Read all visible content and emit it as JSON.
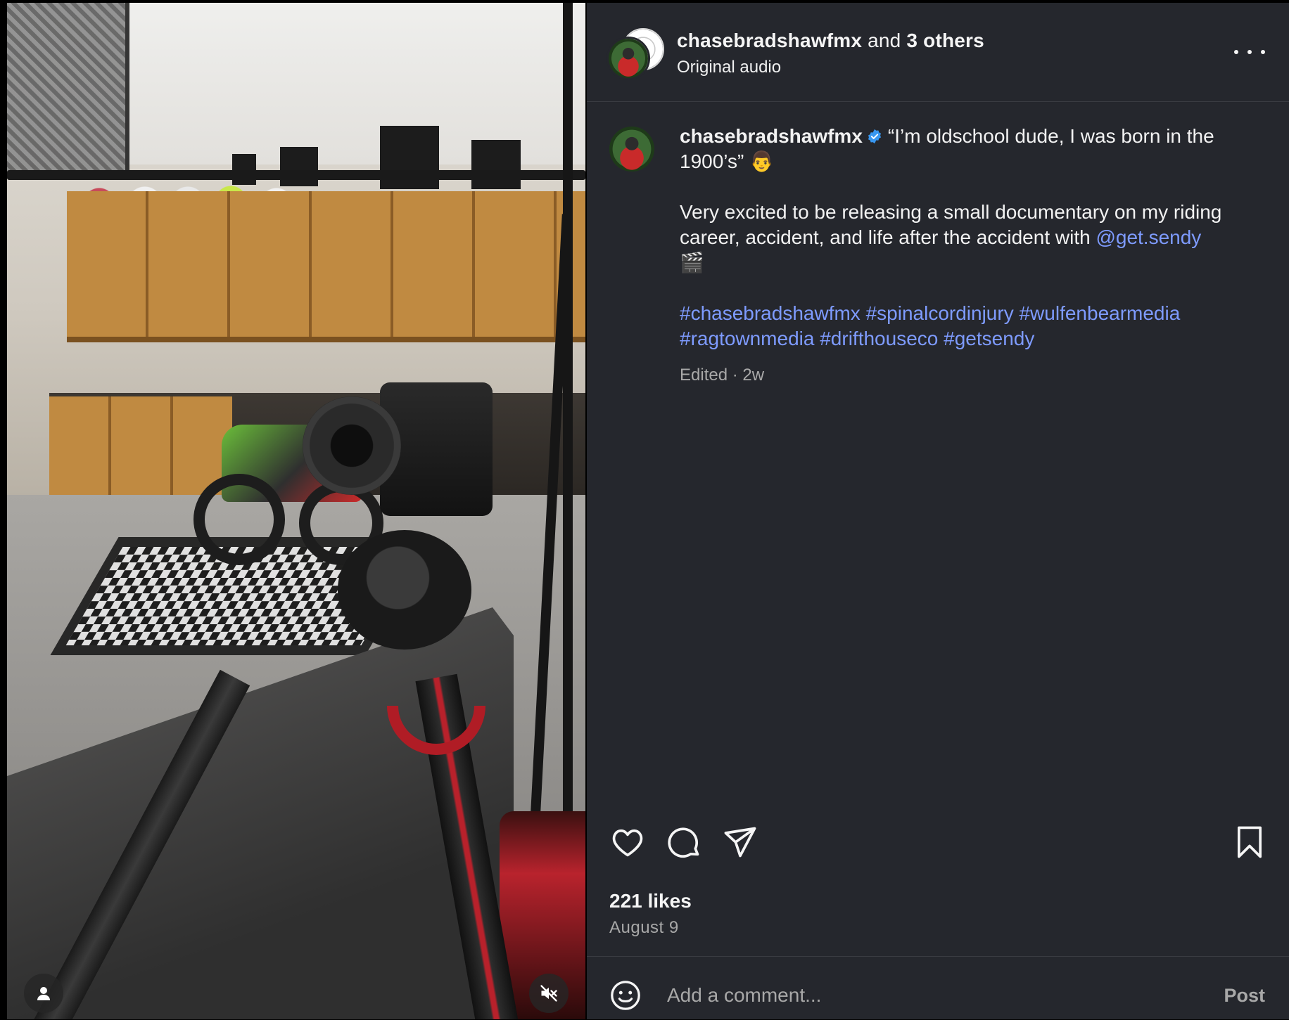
{
  "header": {
    "username": "chasebradshawfmx",
    "connector": "and",
    "others": "3 others",
    "subtitle": "Original audio",
    "more_icon": "more-horizontal-icon"
  },
  "caption": {
    "username": "chasebradshawfmx",
    "verified_icon": "verified-badge-icon",
    "quote": "“I’m oldschool dude, I was born in the 1900’s” 👨",
    "body": "Very excited to be releasing a small documentary on my riding career, accident, and life after the accident with",
    "mention": "@get.sendy",
    "body_end": "🎬",
    "hashtags": [
      "#chasebradshawfmx",
      "#spinalcordinjury",
      "#wulfenbearmedia",
      "#ragtownmedia",
      "#drifthouseco",
      "#getsendy"
    ],
    "meta": "Edited · 2w"
  },
  "actions": {
    "like_icon": "heart-icon",
    "comment_icon": "comment-icon",
    "share_icon": "share-icon",
    "save_icon": "bookmark-icon"
  },
  "likes": "221 likes",
  "date": "August 9",
  "comment": {
    "placeholder": "Add a comment...",
    "post_label": "Post",
    "emoji_icon": "emoji-icon"
  },
  "media": {
    "user_tag_icon": "user-icon",
    "mute_icon": "muted-speaker-icon"
  },
  "colors": {
    "panel_bg": "#25272d",
    "link": "#7e9bff",
    "verified": "#3897f0",
    "muted_text": "#a8a8a8"
  }
}
